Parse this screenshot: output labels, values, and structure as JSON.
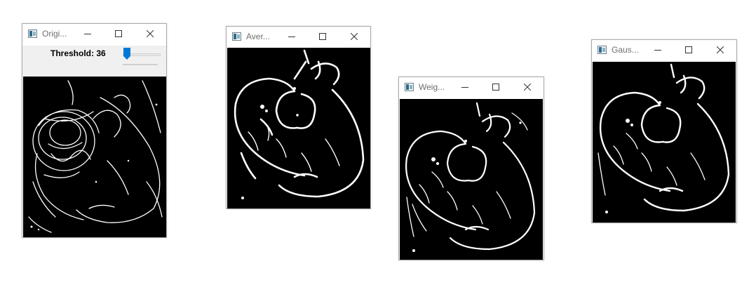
{
  "windows": [
    {
      "id": "original",
      "title": "Origi...",
      "threshold_label": "Threshold: 36",
      "threshold_value": 36
    },
    {
      "id": "average",
      "title": "Aver..."
    },
    {
      "id": "weighted",
      "title": "Weig..."
    },
    {
      "id": "gaussian",
      "title": "Gaus..."
    }
  ],
  "icons": {
    "app": "opencv-window-icon",
    "minimize": "minimize-icon",
    "maximize": "maximize-icon",
    "close": "close-icon"
  },
  "colors": {
    "accent": "#0078d7",
    "image_background": "#000000",
    "edges": "#ffffff",
    "toolbar": "#f0f0f0"
  }
}
